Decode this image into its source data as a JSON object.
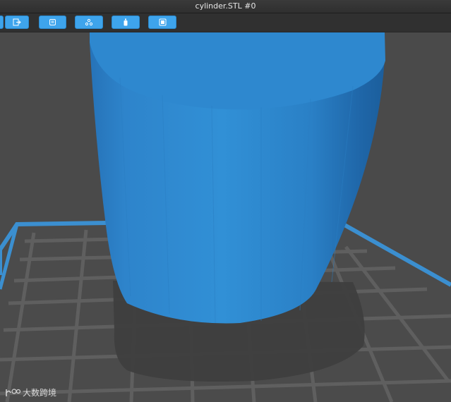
{
  "window": {
    "title": "cylinder.STL #0"
  },
  "toolbar": {
    "buttons": [
      {
        "icon": "export-icon"
      },
      {
        "icon": "layers-icon"
      },
      {
        "icon": "support-icon"
      },
      {
        "icon": "bottle-icon"
      },
      {
        "icon": "view-icon"
      }
    ]
  },
  "viewport": {
    "model_color": "#2f87cc",
    "bed_border_color": "#3b8fd0",
    "background_color": "#4a4a4a"
  },
  "watermark": {
    "text": "大数跨境"
  }
}
